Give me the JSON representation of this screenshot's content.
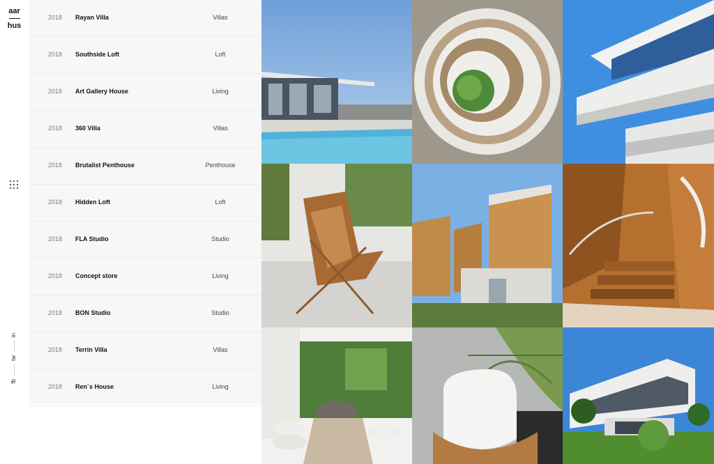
{
  "brand": {
    "line1": "aar",
    "line2": "hus"
  },
  "social": [
    {
      "label": "in",
      "icon": "linkedin-icon"
    },
    {
      "label": "tw",
      "icon": "twitter-icon"
    },
    {
      "label": "fb",
      "icon": "facebook-icon"
    }
  ],
  "menu_icon": "grid-menu-icon",
  "projects": [
    {
      "year": "2018",
      "name": "Rayan Villa",
      "category": "Villas"
    },
    {
      "year": "2018",
      "name": "Southside Loft",
      "category": "Loft"
    },
    {
      "year": "2018",
      "name": "Art Gallery House",
      "category": "Living"
    },
    {
      "year": "2018",
      "name": "360 Villa",
      "category": "Villas"
    },
    {
      "year": "2018",
      "name": "Brutalist Penthouse",
      "category": "Penthouse"
    },
    {
      "year": "2018",
      "name": "Hidden Loft",
      "category": "Loft"
    },
    {
      "year": "2018",
      "name": "FLA Studio",
      "category": "Studio"
    },
    {
      "year": "2018",
      "name": "Concept store",
      "category": "Living"
    },
    {
      "year": "2018",
      "name": "BON Studio",
      "category": "Studio"
    },
    {
      "year": "2018",
      "name": "Terrin Villa",
      "category": "Villas"
    },
    {
      "year": "2018",
      "name": "Ren´s House",
      "category": "Living"
    }
  ],
  "colors": {
    "list_bg": "#f7f7f7",
    "text": "#111111",
    "muted": "#7b7b7b",
    "divider": "#ececec"
  }
}
